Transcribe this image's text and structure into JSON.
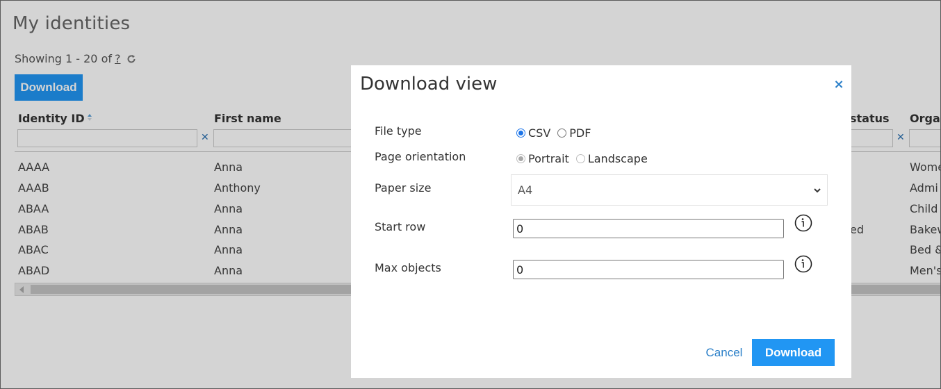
{
  "page": {
    "title": "My identities",
    "showing_prefix": "Showing 1 - 20 of",
    "showing_total": "?",
    "download_label": "Download"
  },
  "grid": {
    "columns": [
      {
        "label": "Identity ID"
      },
      {
        "label": "First name"
      },
      {
        "label": "status"
      },
      {
        "label": "Orga"
      }
    ],
    "rows": [
      {
        "id": "AAAA",
        "first_name": "Anna",
        "status": "",
        "org": "Wome"
      },
      {
        "id": "AAAB",
        "first_name": "Anthony",
        "status": "",
        "org": "Admi"
      },
      {
        "id": "ABAA",
        "first_name": "Anna",
        "status": "",
        "org": "Child"
      },
      {
        "id": "ABAB",
        "first_name": "Anna",
        "status": "ed",
        "org": "Bakew"
      },
      {
        "id": "ABAC",
        "first_name": "Anna",
        "status": "",
        "org": "Bed &"
      },
      {
        "id": "ABAD",
        "first_name": "Anna",
        "status": "",
        "org": "Men's"
      }
    ]
  },
  "modal": {
    "title": "Download view",
    "close_symbol": "×",
    "file_type": {
      "label": "File type",
      "options": [
        "CSV",
        "PDF"
      ],
      "selected": "CSV"
    },
    "page_orientation": {
      "label": "Page orientation",
      "options": [
        "Portrait",
        "Landscape"
      ],
      "selected": "Portrait",
      "disabled": true
    },
    "paper_size": {
      "label": "Paper size",
      "value": "A4"
    },
    "start_row": {
      "label": "Start row",
      "value": "0"
    },
    "max_objects": {
      "label": "Max objects",
      "value": "0"
    },
    "cancel_label": "Cancel",
    "download_label": "Download"
  },
  "colors": {
    "accent": "#2196f3",
    "link": "#2a7fc8",
    "overlay": "rgba(0,0,0,0.17)"
  },
  "icons": [
    "refresh-icon",
    "sort-icon",
    "clear-filter-icon",
    "close-icon",
    "chevron-down-icon",
    "info-icon"
  ]
}
